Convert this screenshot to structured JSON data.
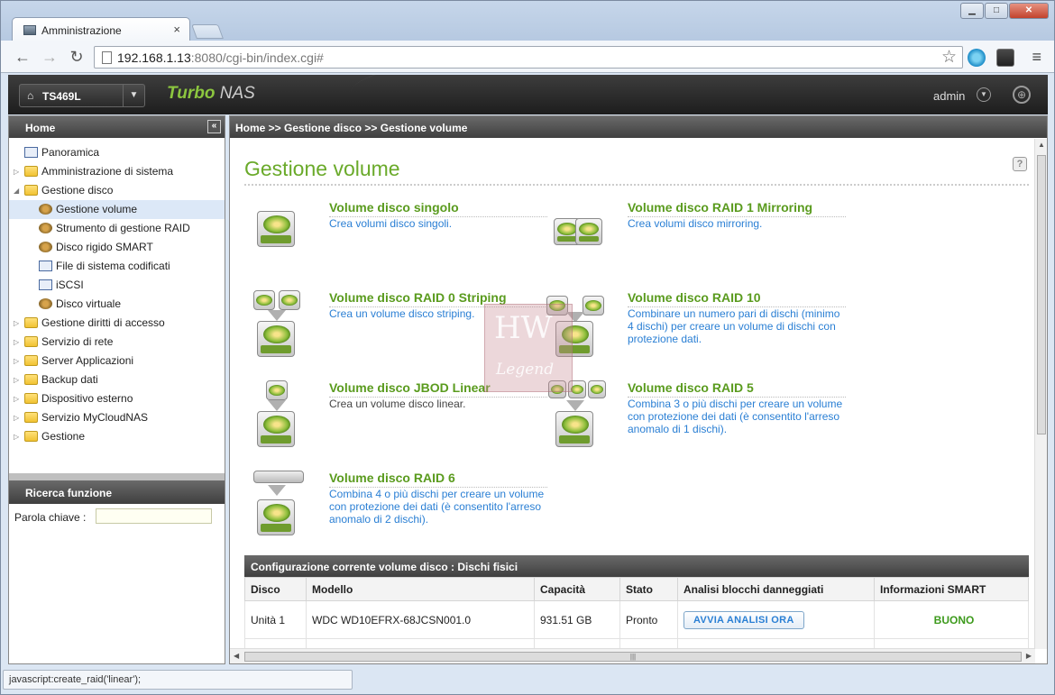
{
  "browser": {
    "tab_title": "Amministrazione",
    "tab_close": "×",
    "url_host": "192.168.1.13",
    "url_rest": ":8080/cgi-bin/index.cgi#",
    "status": "javascript:create_raid('linear');"
  },
  "header": {
    "model": "TS469L",
    "brand_turbo": "Turbo",
    "brand_nas": "NAS",
    "user": "admin"
  },
  "sidebar": {
    "title": "Home",
    "items": [
      {
        "label": "Panoramica"
      },
      {
        "label": "Amministrazione di sistema"
      },
      {
        "label": "Gestione disco"
      },
      {
        "label": "Gestione volume"
      },
      {
        "label": "Strumento di gestione RAID"
      },
      {
        "label": "Disco rigido SMART"
      },
      {
        "label": "File di sistema codificati"
      },
      {
        "label": "iSCSI"
      },
      {
        "label": "Disco virtuale"
      },
      {
        "label": "Gestione diritti di accesso"
      },
      {
        "label": "Servizio di rete"
      },
      {
        "label": "Server Applicazioni"
      },
      {
        "label": "Backup dati"
      },
      {
        "label": "Dispositivo esterno"
      },
      {
        "label": "Servizio MyCloudNAS"
      },
      {
        "label": "Gestione"
      }
    ],
    "search_title": "Ricerca funzione",
    "search_label": "Parola chiave :"
  },
  "main": {
    "breadcrumb": "Home >> Gestione disco >> Gestione volume",
    "title": "Gestione volume",
    "options": [
      {
        "title": "Volume disco singolo",
        "desc": "Crea volumi disco singoli."
      },
      {
        "title": "Volume disco RAID 1 Mirroring",
        "desc": "Crea volumi disco mirroring."
      },
      {
        "title": "Volume disco RAID 0 Striping",
        "desc": "Crea un volume disco striping."
      },
      {
        "title": "Volume disco RAID 10",
        "desc": "Combinare un numero pari di dischi (minimo 4 dischi) per creare un volume di dischi con protezione dati."
      },
      {
        "title": "Volume disco JBOD Linear",
        "desc": "Crea un volume disco linear."
      },
      {
        "title": "Volume disco RAID 5",
        "desc": "Combina 3 o più dischi per creare un volume con protezione dei dati (è consentito l'arreso anomalo di 1 dischi)."
      },
      {
        "title": "Volume disco RAID 6",
        "desc": "Combina 4 o più dischi per creare un volume con protezione dei dati (è consentito l'arreso anomalo di 2 dischi)."
      }
    ],
    "watermark_lines": [
      "HW",
      "Legend"
    ],
    "table": {
      "title": "Configurazione corrente volume disco : Dischi fisici",
      "columns": [
        "Disco",
        "Modello",
        "Capacità",
        "Stato",
        "Analisi blocchi danneggiati",
        "Informazioni SMART"
      ],
      "rows": [
        {
          "disk": "Unità 1",
          "model": "WDC WD10EFRX-68JCSN001.0",
          "capacity": "931.51 GB",
          "state": "Pronto",
          "action": "AVVIA ANALISI ORA",
          "smart": "BUONO"
        }
      ]
    }
  }
}
